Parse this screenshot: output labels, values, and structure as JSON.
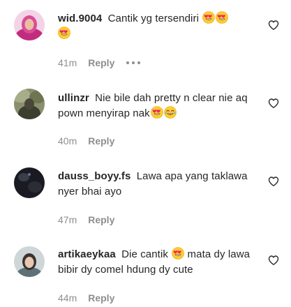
{
  "comments": [
    {
      "username": "wid.9004",
      "text": "Cantik yg tersendiri",
      "emojis": [
        "heart-eyes-emoji",
        "heart-eyes-emoji",
        "heart-eyes-emoji"
      ],
      "time": "41m",
      "reply_label": "Reply",
      "has_more": true
    },
    {
      "username": "ullinzr",
      "text": "Nie bile dah pretty n clear nie aq pown menyirap nak",
      "emojis": [
        "heart-eyes-emoji",
        "tears-of-joy-emoji"
      ],
      "time": "40m",
      "reply_label": "Reply",
      "has_more": false
    },
    {
      "username": "dauss_boyy.fs",
      "text": "Lawa apa yang taklawa nyer bhai ayo",
      "emojis": [],
      "time": "47m",
      "reply_label": "Reply",
      "has_more": false
    },
    {
      "username": "artikaeykaa",
      "text_before": "Die cantik",
      "text_after": "mata dy lawa bibir dy comel hdung dy cute",
      "emojis": [
        "heart-eyes-emoji"
      ],
      "time": "44m",
      "reply_label": "Reply",
      "has_more": false
    }
  ],
  "colors": {
    "text": "#262626",
    "muted": "#8e8e8e",
    "emoji_face": "#ffcc33",
    "emoji_heart": "#f4245e"
  }
}
